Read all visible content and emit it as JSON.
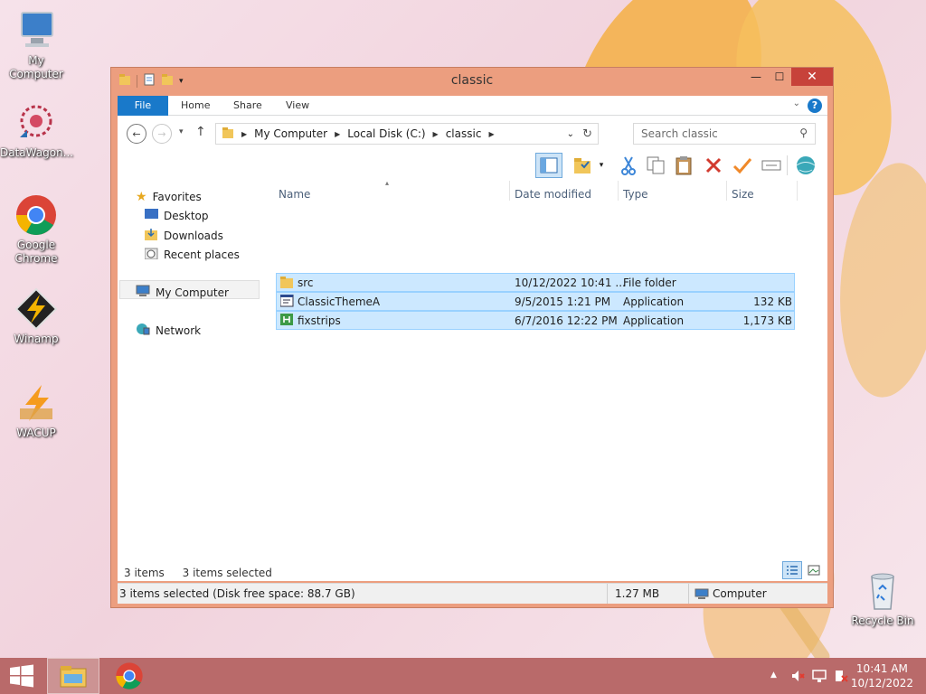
{
  "desktop": {
    "icons": [
      {
        "label": "My Computer"
      },
      {
        "label": "DataWagon..."
      },
      {
        "label": "Google Chrome"
      },
      {
        "label": "Winamp"
      },
      {
        "label": "WACUP"
      },
      {
        "label": "Recycle Bin"
      }
    ]
  },
  "window": {
    "title": "classic",
    "ribbon_tabs": [
      "File",
      "Home",
      "Share",
      "View"
    ],
    "address": {
      "crumbs": [
        "My Computer",
        "Local Disk (C:)",
        "classic"
      ]
    },
    "search_placeholder": "Search classic"
  },
  "nav": {
    "favorites": "Favorites",
    "desktop": "Desktop",
    "downloads": "Downloads",
    "recent": "Recent places",
    "my_computer": "My Computer",
    "network": "Network"
  },
  "columns": {
    "name": "Name",
    "date": "Date modified",
    "type": "Type",
    "size": "Size"
  },
  "files": [
    {
      "name": "src",
      "date": "10/12/2022 10:41 ...",
      "type": "File folder",
      "size": ""
    },
    {
      "name": "ClassicThemeA",
      "date": "9/5/2015 1:21 PM",
      "type": "Application",
      "size": "132 KB"
    },
    {
      "name": "fixstrips",
      "date": "6/7/2016 12:22 PM",
      "type": "Application",
      "size": "1,173 KB"
    }
  ],
  "status": {
    "items": "3 items",
    "selected": "3 items selected",
    "bar_text": "3 items selected (Disk free space: 88.7 GB)",
    "size": "1.27 MB",
    "location": "Computer"
  },
  "taskbar": {
    "time": "10:41 AM",
    "date": "10/12/2022"
  },
  "colors": {
    "file_tab": "#1979ca",
    "selection": "#cce8ff",
    "title_bar": "#ec9e7f",
    "taskbar": "#b96a6a",
    "close": "#c7423a"
  }
}
